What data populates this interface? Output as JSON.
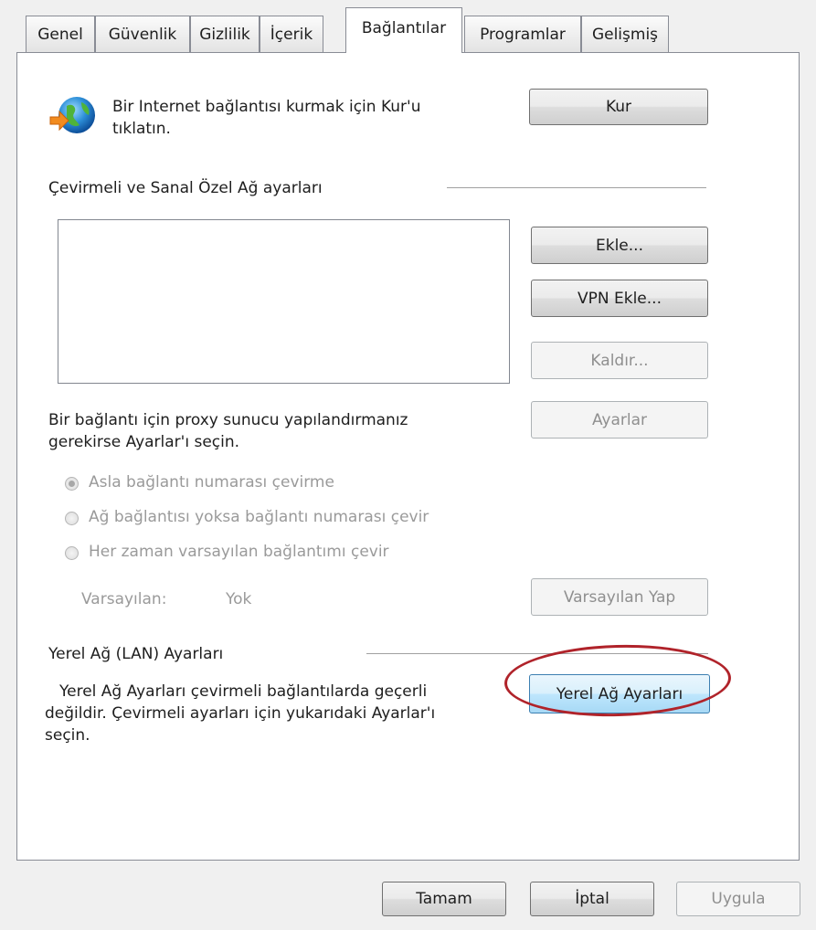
{
  "tabs": [
    {
      "label": "Genel"
    },
    {
      "label": "Güvenlik"
    },
    {
      "label": "Gizlilik"
    },
    {
      "label": "İçerik"
    },
    {
      "label": "Bağlantılar"
    },
    {
      "label": "Programlar"
    },
    {
      "label": "Gelişmiş"
    }
  ],
  "active_tab": "Bağlantılar",
  "setup": {
    "text_line1": "Bir Internet bağlantısı kurmak için Kur'u",
    "text_line2": "tıklatın.",
    "button": "Kur",
    "icon": "globe-connect-icon"
  },
  "dialup": {
    "title": "Çevirmeli ve Sanal Özel Ağ ayarları",
    "add_button": "Ekle...",
    "add_vpn_button": "VPN Ekle...",
    "remove_button": "Kaldır...",
    "proxy_text_line1": "Bir bağlantı için proxy sunucu yapılandırmanız",
    "proxy_text_line2": "gerekirse Ayarlar'ı seçin.",
    "settings_button": "Ayarlar",
    "radio_options": [
      {
        "label": "Asla bağlantı numarası çevirme",
        "checked": true
      },
      {
        "label": "Ağ bağlantısı yoksa bağlantı numarası çevir",
        "checked": false
      },
      {
        "label": "Her zaman varsayılan bağlantımı çevir",
        "checked": false
      }
    ],
    "default_label": "Varsayılan:",
    "default_value": "Yok",
    "set_default_button": "Varsayılan Yap"
  },
  "lan": {
    "title": "Yerel Ağ (LAN) Ayarları",
    "text_line1": "Yerel Ağ Ayarları çevirmeli bağlantılarda geçerli",
    "text_line2": "değildir. Çevirmeli ayarları için yukarıdaki Ayarlar'ı",
    "text_line3": "seçin.",
    "button": "Yerel Ağ Ayarları",
    "highlight_color": "#b0232a"
  },
  "footer": {
    "ok": "Tamam",
    "cancel": "İptal",
    "apply": "Uygula"
  }
}
